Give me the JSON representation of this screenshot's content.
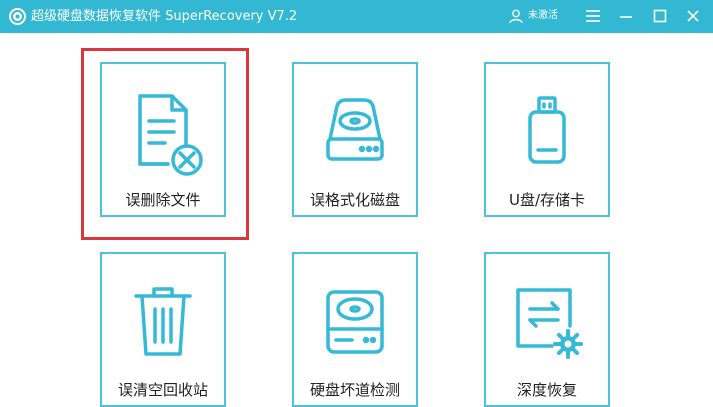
{
  "app": {
    "title": "超级硬盘数据恢复软件 SuperRecovery V7.2",
    "user_status": "未激活"
  },
  "colors": {
    "titlebar": "#33b8d3",
    "card_border": "#4cc3db",
    "icon_stroke": "#35b9d6",
    "selection": "#d9363e"
  },
  "cards": [
    {
      "label": "误删除文件",
      "icon": "file-x-icon"
    },
    {
      "label": "误格式化磁盘",
      "icon": "hard-disk-icon"
    },
    {
      "label": "U盘/存储卡",
      "icon": "usb-drive-icon"
    },
    {
      "label": "误清空回收站",
      "icon": "trash-icon"
    },
    {
      "label": "硬盘坏道检测",
      "icon": "disk-check-icon"
    },
    {
      "label": "深度恢复",
      "icon": "deep-recovery-icon"
    }
  ],
  "selected_card": "误删除文件"
}
